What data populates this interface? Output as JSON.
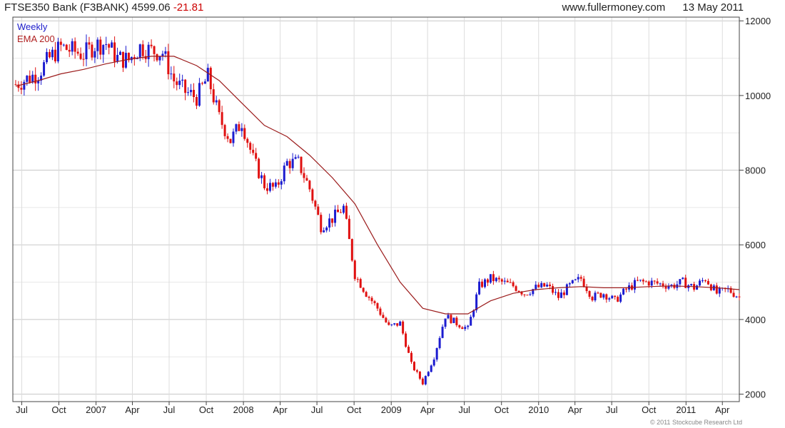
{
  "header": {
    "title": "FTSE350 Bank (F3BANK)",
    "price": "4599.06",
    "change": "-21.81",
    "site": "www.fullermoney.com",
    "date": "13 May 2011"
  },
  "footer": {
    "copyright": "© 2011 Stockcube Research Ltd"
  },
  "colors": {
    "up": "#1c1cd0",
    "down": "#e01010",
    "ema": "#9b1b1b",
    "grid": "#d8d8d8"
  },
  "chart_data": {
    "type": "line",
    "legend": [
      "Weekly",
      "EMA 200"
    ],
    "x_tick_labels": [
      "Jul",
      "Oct",
      "2007",
      "Apr",
      "Jul",
      "Oct",
      "2008",
      "Apr",
      "Jul",
      "Oct",
      "2009",
      "Apr",
      "Jul",
      "Oct",
      "2010",
      "Apr",
      "Jul",
      "Oct",
      "2011",
      "Apr"
    ],
    "y_tick_labels": [
      "12000",
      "10000",
      "8000",
      "6000",
      "4000",
      "2000"
    ],
    "ylim": [
      1800,
      12100
    ],
    "x_date_range": [
      "2006-06-09",
      "2011-05-13"
    ],
    "grid": true,
    "series": [
      {
        "name": "Weekly",
        "x": [
          "2006-06-16",
          "2006-07-14",
          "2006-08-11",
          "2006-09-08",
          "2006-10-06",
          "2006-11-03",
          "2006-12-01",
          "2006-12-29",
          "2007-01-26",
          "2007-02-23",
          "2007-03-23",
          "2007-04-20",
          "2007-05-18",
          "2007-06-15",
          "2007-07-13",
          "2007-08-10",
          "2007-09-07",
          "2007-10-05",
          "2007-11-02",
          "2007-11-30",
          "2007-12-28",
          "2008-01-25",
          "2008-02-22",
          "2008-03-21",
          "2008-04-18",
          "2008-05-16",
          "2008-06-13",
          "2008-07-11",
          "2008-08-08",
          "2008-09-05",
          "2008-10-03",
          "2008-10-31",
          "2008-11-28",
          "2008-12-26",
          "2009-01-23",
          "2009-02-20",
          "2009-03-20",
          "2009-04-17",
          "2009-05-15",
          "2009-06-12",
          "2009-07-10",
          "2009-08-07",
          "2009-09-04",
          "2009-10-02",
          "2009-10-30",
          "2009-11-27",
          "2009-12-25",
          "2010-01-22",
          "2010-02-19",
          "2010-03-19",
          "2010-04-16",
          "2010-05-14",
          "2010-06-11",
          "2010-07-09",
          "2010-08-06",
          "2010-09-03",
          "2010-10-01",
          "2010-10-29",
          "2010-11-26",
          "2010-12-24",
          "2011-01-21",
          "2011-02-18",
          "2011-03-18",
          "2011-04-15",
          "2011-05-13"
        ],
        "y": [
          10300,
          10450,
          10600,
          11000,
          11300,
          11200,
          11100,
          11350,
          11400,
          11000,
          10950,
          11300,
          11200,
          11150,
          10400,
          10100,
          9950,
          10500,
          9400,
          8800,
          9300,
          8300,
          7600,
          7500,
          8200,
          8200,
          7500,
          6500,
          6700,
          7000,
          5200,
          4700,
          4300,
          3800,
          3900,
          2800,
          2300,
          3000,
          4100,
          3900,
          3750,
          4900,
          5100,
          5000,
          4900,
          4700,
          4850,
          4900,
          4600,
          4900,
          5100,
          4600,
          4700,
          4500,
          4800,
          5000,
          5000,
          4950,
          4900,
          5000,
          4850,
          5100,
          4700,
          4800,
          4600
        ]
      },
      {
        "name": "EMA 200",
        "x": [
          "2006-06-16",
          "2006-08-11",
          "2006-10-06",
          "2006-12-01",
          "2007-01-26",
          "2007-03-23",
          "2007-05-18",
          "2007-07-13",
          "2007-09-07",
          "2007-11-02",
          "2007-12-28",
          "2008-02-22",
          "2008-04-18",
          "2008-06-13",
          "2008-08-08",
          "2008-10-03",
          "2008-11-28",
          "2009-01-23",
          "2009-03-20",
          "2009-05-15",
          "2009-07-10",
          "2009-09-04",
          "2009-10-30",
          "2009-12-25",
          "2010-02-19",
          "2010-04-16",
          "2010-06-11",
          "2010-08-06",
          "2010-10-01",
          "2010-11-26",
          "2011-01-21",
          "2011-03-18",
          "2011-05-13"
        ],
        "y": [
          10250,
          10400,
          10580,
          10700,
          10850,
          10970,
          11050,
          11050,
          10800,
          10400,
          9800,
          9200,
          8900,
          8400,
          7800,
          7100,
          6000,
          5000,
          4300,
          4150,
          4150,
          4500,
          4700,
          4800,
          4850,
          4880,
          4850,
          4850,
          4880,
          4900,
          4880,
          4850,
          4800
        ]
      }
    ]
  }
}
